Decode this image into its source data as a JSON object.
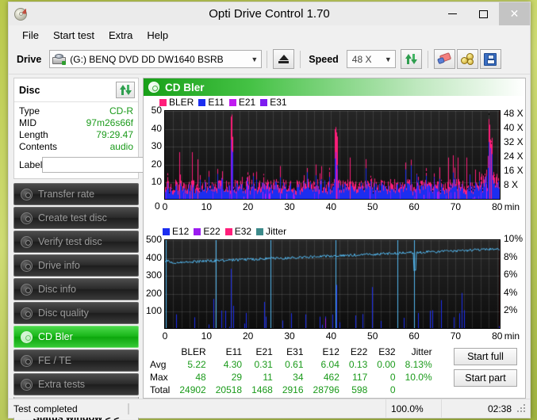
{
  "window": {
    "title": "Opti Drive Control 1.70",
    "app_icon": "cd-disc-icon",
    "minimize": "–",
    "maximize": "▢",
    "close": "✕"
  },
  "menubar": {
    "items": [
      "File",
      "Start test",
      "Extra",
      "Help"
    ]
  },
  "toolbar": {
    "drive_label": "Drive",
    "drive_value": "(G:)  BENQ DVD DD DW1640 BSRB",
    "eject_title": "eject-button",
    "speed_label": "Speed",
    "speed_value": "48 X",
    "refresh_title": "refresh-button",
    "erase_title": "erase-button",
    "gold_title": "bitsetting-button",
    "save_title": "save-button"
  },
  "sidebar": {
    "disc_panel": {
      "title": "Disc",
      "refresh_icon": "refresh-icon",
      "rows": [
        {
          "key": "Type",
          "value": "CD-R"
        },
        {
          "key": "MID",
          "value": "97m26s66f"
        },
        {
          "key": "Length",
          "value": "79:29.47"
        },
        {
          "key": "Contents",
          "value": "audio"
        }
      ],
      "label_key": "Label",
      "label_value": "",
      "label_placeholder": ""
    },
    "nav_items": [
      {
        "label": "Transfer rate",
        "active": false
      },
      {
        "label": "Create test disc",
        "active": false
      },
      {
        "label": "Verify test disc",
        "active": false
      },
      {
        "label": "Drive info",
        "active": false
      },
      {
        "label": "Disc info",
        "active": false
      },
      {
        "label": "Disc quality",
        "active": false
      },
      {
        "label": "CD Bler",
        "active": true
      },
      {
        "label": "FE / TE",
        "active": false
      },
      {
        "label": "Extra tests",
        "active": false
      }
    ],
    "status_window_button": "Status window > >"
  },
  "main": {
    "header_title": "CD Bler",
    "header_icon": "cd-disc-icon"
  },
  "chart_data": [
    {
      "type": "line",
      "name": "cd-bler-chart",
      "title": "CD Bler",
      "xlabel": "min",
      "ylabel": "",
      "xticks": [
        0,
        10,
        20,
        30,
        40,
        50,
        60,
        70,
        80
      ],
      "xlim": [
        0,
        81
      ],
      "yticks": [
        10,
        20,
        30,
        40,
        50
      ],
      "ylim": [
        0,
        50
      ],
      "y2ticks": [
        "8 X",
        "16 X",
        "24 X",
        "32 X",
        "40 X",
        "48 X"
      ],
      "y2lim": [
        0,
        50
      ],
      "grid": true,
      "legend_position": "top-left",
      "legend": [
        {
          "name": "BLER",
          "color": "#ff1e7a"
        },
        {
          "name": "E11",
          "color": "#1c2ef0"
        },
        {
          "name": "E21",
          "color": "#c01cf0"
        },
        {
          "name": "E31",
          "color": "#7d1cf0"
        }
      ],
      "series": [
        {
          "name": "BLER",
          "color": "#ff1e7a",
          "avg": 5.22,
          "max": 48,
          "total": 24902
        },
        {
          "name": "E11",
          "color": "#1c2ef0",
          "avg": 4.3,
          "max": 29,
          "total": 20518
        },
        {
          "name": "E21",
          "color": "#c01cf0",
          "avg": 0.31,
          "max": 11,
          "total": 1468
        },
        {
          "name": "E31",
          "color": "#7d1cf0",
          "avg": 0.61,
          "max": 34,
          "total": 2916
        }
      ],
      "notes": "Dense per-minute error spikes; BLER peaks ~48 at 16 min, ~41 at 41 min, ~37 near 78 min."
    },
    {
      "type": "line",
      "name": "e12-jitter-chart",
      "title": "",
      "xlabel": "min",
      "ylabel": "",
      "xticks": [
        0,
        10,
        20,
        30,
        40,
        50,
        60,
        70,
        80
      ],
      "xlim": [
        0,
        81
      ],
      "yticks": [
        100,
        200,
        300,
        400,
        500
      ],
      "ylim": [
        0,
        500
      ],
      "y2ticks": [
        "2%",
        "4%",
        "6%",
        "8%",
        "10%"
      ],
      "y2lim": [
        0,
        10
      ],
      "grid": true,
      "legend_position": "top-left",
      "legend": [
        {
          "name": "E12",
          "color": "#1c2ef0"
        },
        {
          "name": "E22",
          "color": "#9b1cf0"
        },
        {
          "name": "E32",
          "color": "#ff1e7a"
        },
        {
          "name": "Jitter",
          "color": "#3d8a8a"
        }
      ],
      "series": [
        {
          "name": "E12",
          "color": "#1c2ef0",
          "avg": 6.04,
          "max": 462,
          "total": 28796
        },
        {
          "name": "E22",
          "color": "#9b1cf0",
          "avg": 0.13,
          "max": 117,
          "total": 598
        },
        {
          "name": "E32",
          "color": "#ff1e7a",
          "avg": 0.0,
          "max": 0,
          "total": 0
        },
        {
          "name": "Jitter",
          "color": "#53b8f0",
          "avg": "8.13%",
          "max": "10.0%",
          "total": ""
        }
      ],
      "notes": "Jitter trace rises from ~7.6% at start to ~9% near end; speed-change drops at 12, 25.5, 41 and 60 min."
    }
  ],
  "stats": {
    "columns": [
      "BLER",
      "E11",
      "E21",
      "E31",
      "E12",
      "E22",
      "E32",
      "Jitter"
    ],
    "rows": [
      {
        "label": "Avg",
        "values": [
          "5.22",
          "4.30",
          "0.31",
          "0.61",
          "6.04",
          "0.13",
          "0.00",
          "8.13%"
        ]
      },
      {
        "label": "Max",
        "values": [
          "48",
          "29",
          "11",
          "34",
          "462",
          "117",
          "0",
          "10.0%"
        ]
      },
      {
        "label": "Total",
        "values": [
          "24902",
          "20518",
          "1468",
          "2916",
          "28796",
          "598",
          "0",
          ""
        ]
      }
    ],
    "start_full": "Start full",
    "start_part": "Start part"
  },
  "statusbar": {
    "message": "Test completed",
    "progress_percent": "100.0%",
    "progress_value": 100,
    "elapsed": "02:38"
  },
  "colors": {
    "accent_green": "#18a018",
    "value_green": "#1a9a1a",
    "bler_pink": "#ff1e7a",
    "e11_blue": "#1c2ef0",
    "e21_purple": "#c01cf0",
    "e31_violet": "#7d1cf0",
    "jitter_cyan": "#53b8f0",
    "end_marker_red": "#e02020",
    "plot_bg": "#1b1b1b"
  }
}
